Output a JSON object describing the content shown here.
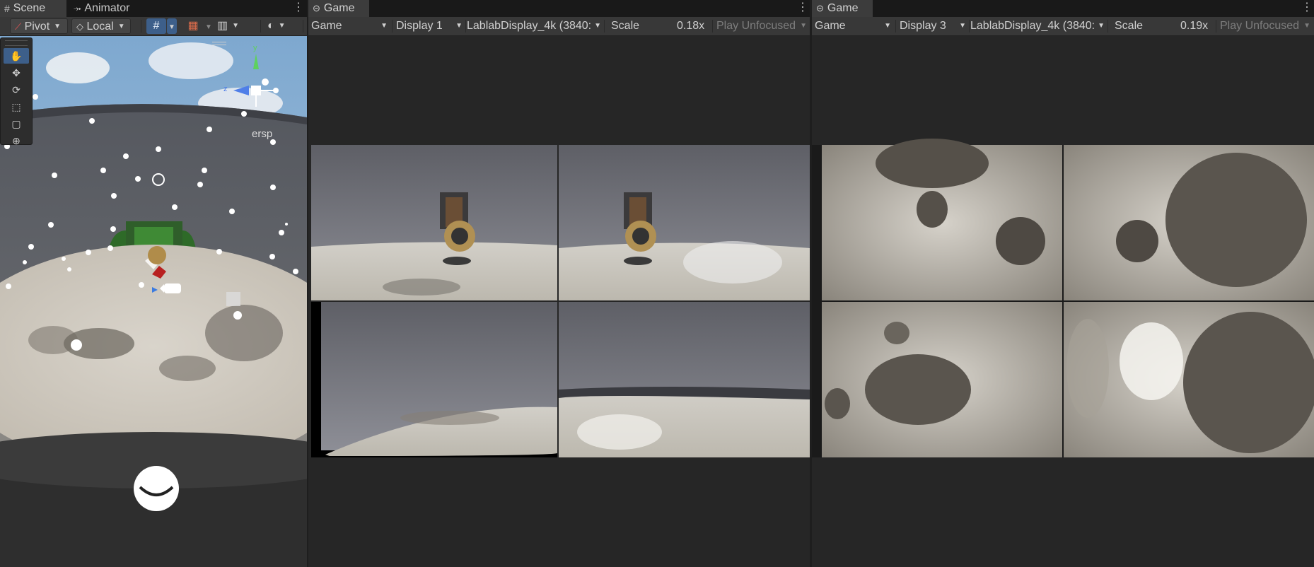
{
  "scene_panel": {
    "tabs": [
      {
        "label": "Scene",
        "icon": "hash-grid-icon",
        "active": true
      },
      {
        "label": "Animator",
        "icon": "animator-icon",
        "active": false
      }
    ],
    "toolbar": {
      "pivot_label": "Pivot",
      "local_label": "Local"
    },
    "tools": [
      "hand-tool",
      "move-tool",
      "rotate-tool",
      "scale-tool",
      "rect-tool",
      "transform-tool"
    ],
    "gizmo": {
      "y": "y",
      "z": "z",
      "projection": "ersp"
    }
  },
  "game_panel_1": {
    "tab_label": "Game",
    "mode_label": "Game",
    "display_label": "Display 1",
    "resolution_label": "LablabDisplay_4k (3840:",
    "scale_label": "Scale",
    "scale_value": "0.18x",
    "play_focus_label": "Play Unfocused"
  },
  "game_panel_2": {
    "tab_label": "Game",
    "mode_label": "Game",
    "display_label": "Display 3",
    "resolution_label": "LablabDisplay_4k (3840:",
    "scale_label": "Scale",
    "scale_value": "0.19x",
    "play_focus_label": "Play Unfocused"
  },
  "colors": {
    "background": "#1e1e1e",
    "panel": "#2b2b2b",
    "tabbar": "#191919",
    "active_tab": "#3c3c3c",
    "toolbar": "#383838",
    "accent_blue": "#3d5f8a"
  }
}
